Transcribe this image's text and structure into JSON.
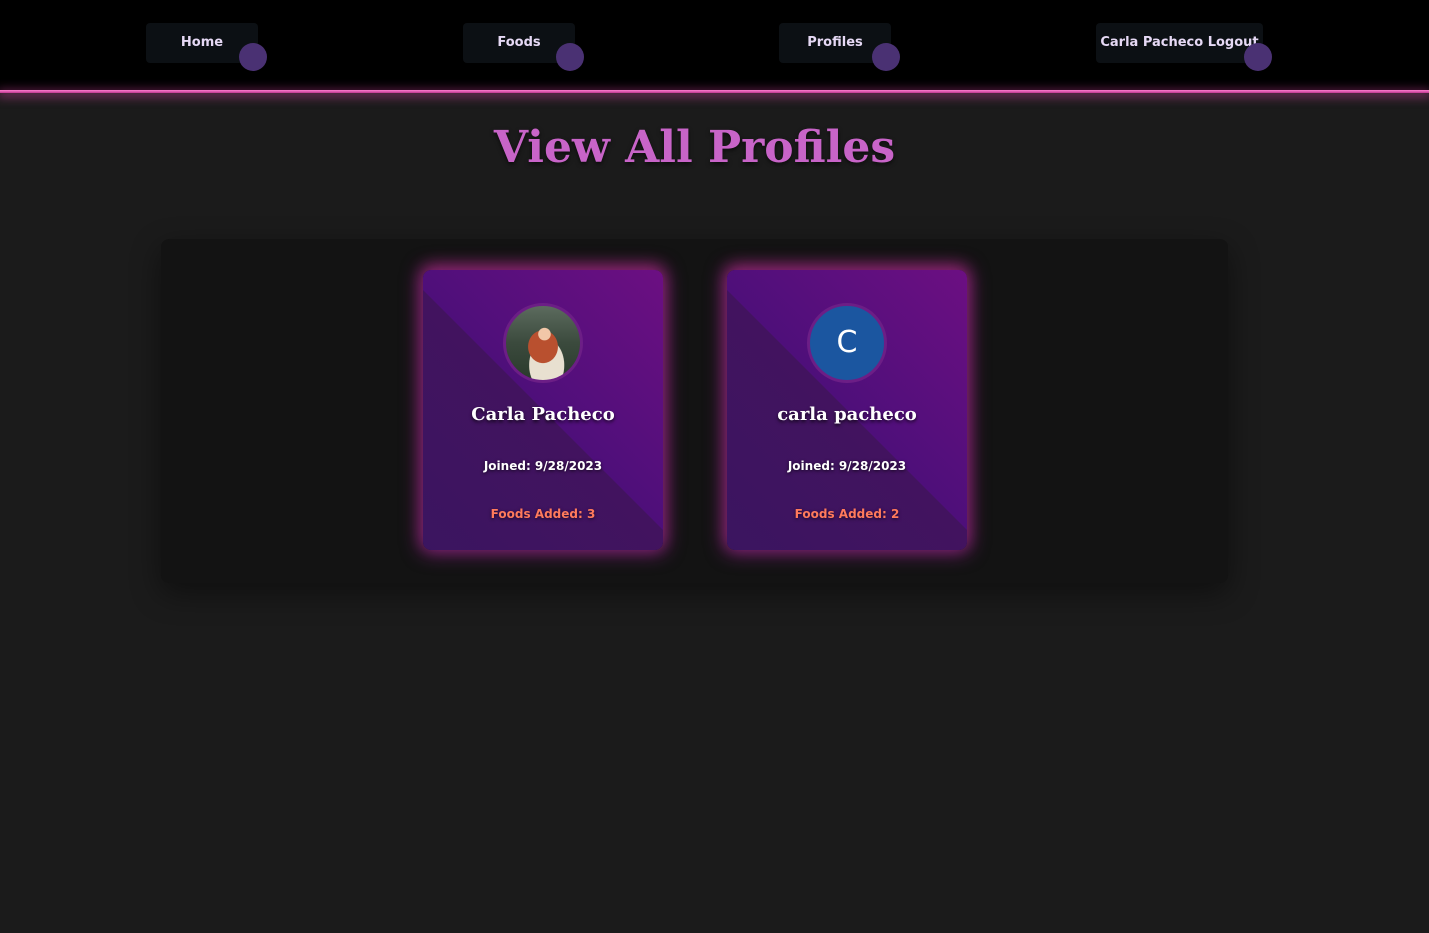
{
  "nav": {
    "items": [
      {
        "label": "Home"
      },
      {
        "label": "Foods"
      },
      {
        "label": "Profiles"
      },
      {
        "label": "Carla Pacheco Logout"
      }
    ]
  },
  "page": {
    "title": "View All Profiles"
  },
  "profiles": [
    {
      "name": "Carla Pacheco",
      "joined": "Joined: 9/28/2023",
      "foods_added": "Foods Added: 3",
      "avatar_type": "photo"
    },
    {
      "name": "carla pacheco",
      "joined": "Joined: 9/28/2023",
      "foods_added": "Foods Added: 2",
      "avatar_type": "letter",
      "avatar_letter": "C"
    }
  ],
  "colors": {
    "accent": "#c864c8",
    "foods_text": "#ff7a5c",
    "avatar_letter_bg": "#1b56a0",
    "nav_dot": "#4a3173"
  }
}
